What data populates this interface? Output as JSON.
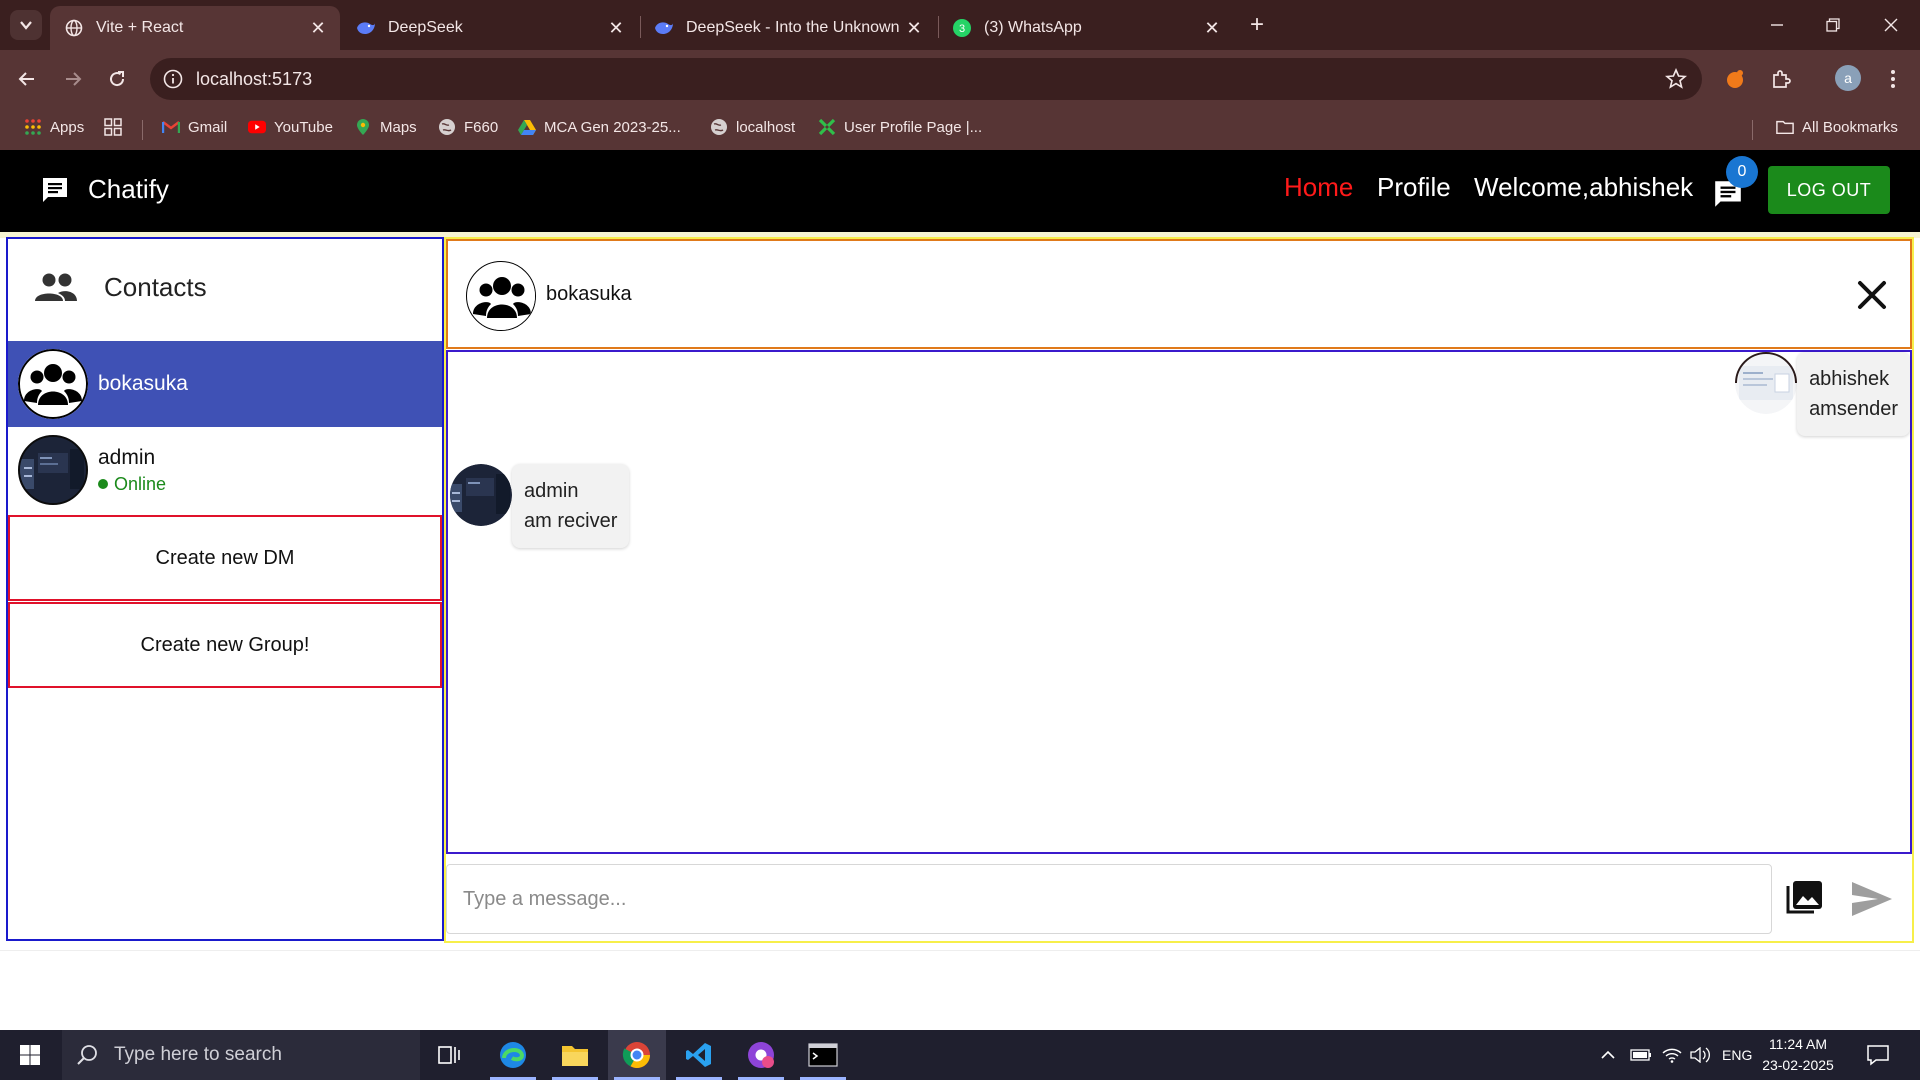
{
  "browser": {
    "tabs": [
      {
        "title": "Vite + React",
        "active": true
      },
      {
        "title": "DeepSeek",
        "active": false
      },
      {
        "title": "DeepSeek - Into the Unknown",
        "active": false
      },
      {
        "title": "(3) WhatsApp",
        "active": false
      }
    ],
    "whatsapp_badge": "3",
    "url": "localhost:5173",
    "profile_initial": "a",
    "bookmarks": [
      {
        "label": "Apps",
        "icon": "apps-grid-icon"
      },
      {
        "label": "Gmail",
        "icon": "gmail-icon"
      },
      {
        "label": "YouTube",
        "icon": "youtube-icon"
      },
      {
        "label": "Maps",
        "icon": "maps-pin-icon"
      },
      {
        "label": "F660",
        "icon": "globe-icon"
      },
      {
        "label": "MCA Gen 2023-25...",
        "icon": "google-drive-icon"
      },
      {
        "label": "localhost",
        "icon": "globe-icon"
      },
      {
        "label": "User Profile Page |...",
        "icon": "puzzle-logo-icon"
      }
    ],
    "all_bookmarks": "All Bookmarks"
  },
  "app": {
    "brand": "Chatify",
    "nav": {
      "home": "Home",
      "profile": "Profile",
      "welcome": "Welcome,abhishek",
      "notification_count": "0",
      "logout": "LOG OUT"
    },
    "colors": {
      "accent_selected": "#3f51b5",
      "home_link": "#ff1a1a",
      "logout_bg": "#1b8a1b",
      "online": "#1b8a1b"
    },
    "contacts": {
      "title": "Contacts",
      "items": [
        {
          "name": "bokasuka",
          "selected": true,
          "status": ""
        },
        {
          "name": "admin",
          "selected": false,
          "status": "Online"
        }
      ],
      "create_dm": "Create new DM",
      "create_group": "Create new Group!"
    },
    "chat": {
      "header_name": "bokasuka",
      "messages": [
        {
          "sender": "abhishek",
          "text": "amsender",
          "side": "right"
        },
        {
          "sender": "admin",
          "text": "am reciver",
          "side": "left"
        }
      ],
      "input_placeholder": "Type a message..."
    }
  },
  "taskbar": {
    "search_placeholder": "Type here to search",
    "language": "ENG",
    "time": "11:24 AM",
    "date": "23-02-2025"
  }
}
